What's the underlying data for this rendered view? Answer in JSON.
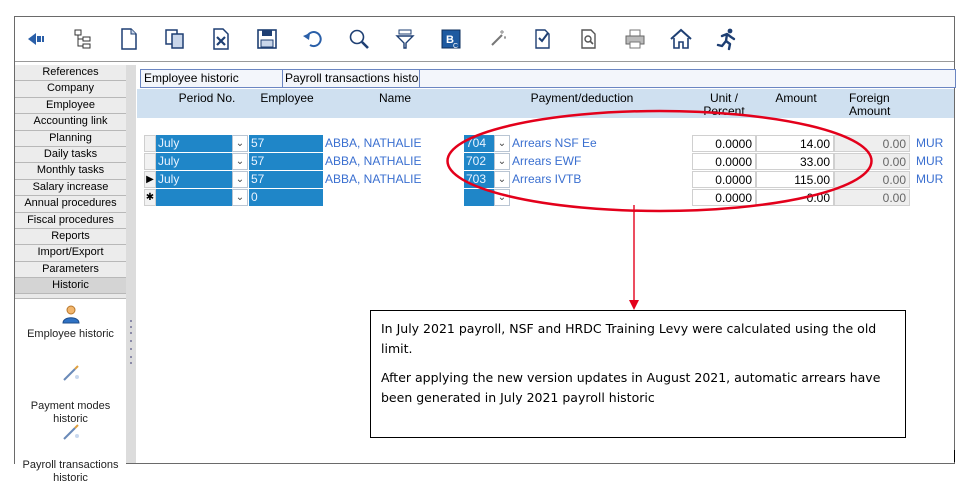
{
  "toolbar": {
    "buttons": [
      {
        "name": "back-icon"
      },
      {
        "name": "tree-icon"
      },
      {
        "name": "new-document-icon"
      },
      {
        "name": "copy-icon"
      },
      {
        "name": "delete-icon"
      },
      {
        "name": "save-icon"
      },
      {
        "name": "undo-icon"
      },
      {
        "name": "search-icon"
      },
      {
        "name": "filter-icon"
      },
      {
        "name": "bc-report-icon"
      },
      {
        "name": "wand-icon"
      },
      {
        "name": "print-preview-icon"
      },
      {
        "name": "zoom-document-icon"
      },
      {
        "name": "printer-icon"
      },
      {
        "name": "home-icon"
      },
      {
        "name": "run-icon"
      }
    ]
  },
  "nav": {
    "items": [
      "References",
      "Company",
      "Employee",
      "Accounting link",
      "Planning",
      "Daily tasks",
      "Monthly tasks",
      "Salary increase",
      "Annual procedures",
      "Fiscal procedures",
      "Reports",
      "Import/Export",
      "Parameters",
      "Historic"
    ],
    "active": "Historic",
    "tools": [
      {
        "label": "Employee historic",
        "icon": "user-icon"
      },
      {
        "label": "Payment modes\nhistoric",
        "icon": "pen-tool-icon"
      },
      {
        "label": "Payroll transactions\nhistoric",
        "icon": "pen-tool-icon"
      }
    ]
  },
  "tabs": [
    "Employee historic",
    "Payroll transactions histo"
  ],
  "grid": {
    "headers": {
      "period": "Period No.",
      "employee": "Employee",
      "name": "Name",
      "payment": "Payment/deduction",
      "unit": "Unit /\nPercent",
      "amount": "Amount",
      "foreign": "Foreign\nAmount"
    },
    "rows": [
      {
        "indicator": "",
        "period": "July",
        "employee": "57",
        "name": "ABBA, NATHALIE",
        "code": "704",
        "payment": "Arrears NSF Ee",
        "unit": "0.0000",
        "amount": "14.00",
        "foreign": "0.00",
        "currency": "MUR"
      },
      {
        "indicator": "",
        "period": "July",
        "employee": "57",
        "name": "ABBA, NATHALIE",
        "code": "702",
        "payment": "Arrears EWF",
        "unit": "0.0000",
        "amount": "33.00",
        "foreign": "0.00",
        "currency": "MUR"
      },
      {
        "indicator": "▶",
        "period": "July",
        "employee": "57",
        "name": "ABBA, NATHALIE",
        "code": "703",
        "payment": "Arrears IVTB",
        "unit": "0.0000",
        "amount": "115.00",
        "foreign": "0.00",
        "currency": "MUR"
      },
      {
        "indicator": "✱",
        "period": "",
        "employee": "0",
        "name": "",
        "code": "",
        "payment": "",
        "unit": "0.0000",
        "amount": "0.00",
        "foreign": "0.00",
        "currency": ""
      }
    ]
  },
  "annotation": {
    "para1": "In July 2021 payroll, NSF and HRDC Training Levy were calculated using the old limit.",
    "para2": "After applying the new version updates in August 2021, automatic arrears have been generated in July 2021 payroll historic",
    "highlight_color": "#e3001b"
  }
}
